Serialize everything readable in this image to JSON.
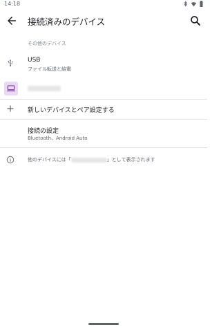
{
  "status_bar": {
    "time": "14:18"
  },
  "app_bar": {
    "title": "接続済みのデバイス"
  },
  "section": {
    "header": "その他のデバイス"
  },
  "rows": {
    "usb": {
      "title": "USB",
      "subtitle": "ファイル転送と給電"
    },
    "pair": {
      "title": "新しいデバイスとペア設定する"
    },
    "connection": {
      "title": "接続の設定",
      "subtitle": "Bluetooth、Android Auto"
    }
  },
  "info": {
    "before": "他のデバイスには「",
    "after": "」として表示されます"
  },
  "colors": {
    "laptop_icon_bg": "#e9d9f2",
    "laptop_icon_fg": "#7b3fa6",
    "accent": "#5f6368"
  }
}
